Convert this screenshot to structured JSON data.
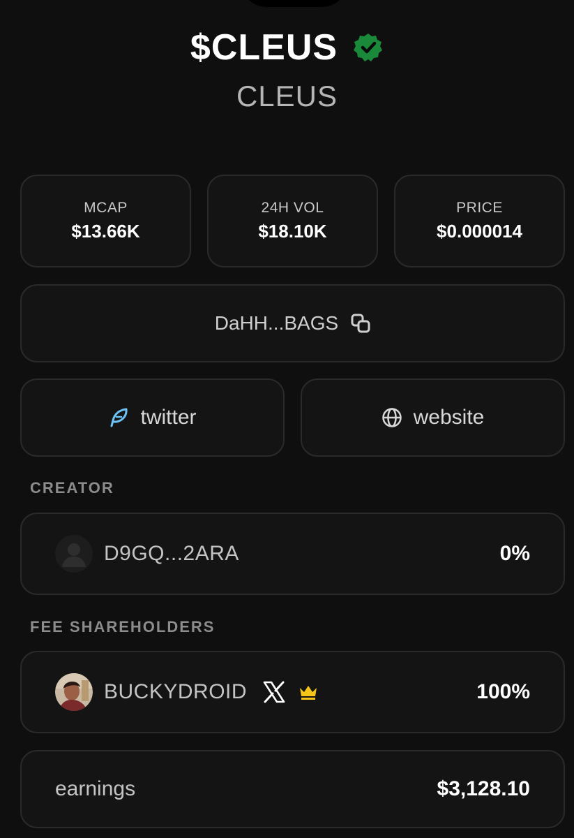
{
  "token": {
    "ticker": "$CLEUS",
    "name": "CLEUS",
    "verified_color": "#1a8a3a"
  },
  "stats": [
    {
      "label": "MCAP",
      "value": "$13.66K"
    },
    {
      "label": "24H VOL",
      "value": "$18.10K"
    },
    {
      "label": "PRICE",
      "value": "$0.000014"
    }
  ],
  "contract": {
    "address": "DaHH...BAGS",
    "icon": "copy-icon"
  },
  "links": {
    "twitter": {
      "label": "twitter",
      "icon": "feather-icon",
      "color": "#6ec3f4"
    },
    "website": {
      "label": "website",
      "icon": "globe-icon"
    }
  },
  "creator": {
    "section_label": "CREATOR",
    "address": "D9GQ...2ARA",
    "share": "0%"
  },
  "fee_shareholders": {
    "section_label": "FEE SHAREHOLDERS",
    "holders": [
      {
        "name": "BUCKYDROID",
        "share": "100%",
        "icons": [
          "x-logo-icon",
          "crown-icon"
        ],
        "crown_color": "#f5c518"
      }
    ]
  },
  "earnings": {
    "label": "earnings",
    "value": "$3,128.10"
  }
}
